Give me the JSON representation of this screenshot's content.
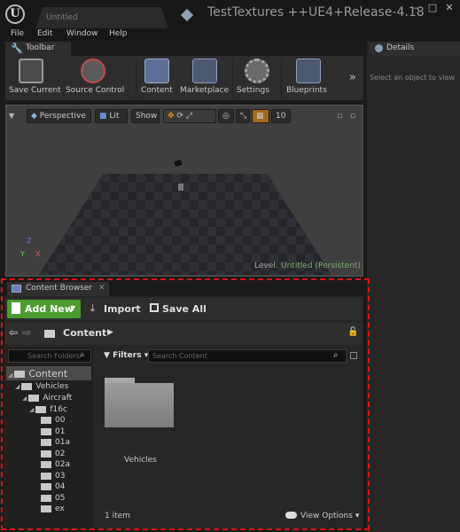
{
  "titlebar": {
    "tab_label": "Untitled",
    "window_title": "TestTextures ++UE4+Release-4.18",
    "controls": [
      "–",
      "□",
      "✕"
    ]
  },
  "menu": [
    "File",
    "Edit",
    "Window",
    "Help"
  ],
  "toolbar": {
    "tab_label": "Toolbar",
    "buttons": [
      "Save Current",
      "Source Control",
      "Content",
      "Marketplace",
      "Settings",
      "Blueprints"
    ]
  },
  "details": {
    "tab_label": "Details",
    "hint": "Select an object to view"
  },
  "viewport": {
    "perspective": "Perspective",
    "lit": "Lit",
    "show": "Show",
    "grid_value": "10",
    "level_label": "Level:",
    "level_name": "Untitled (Persistent)",
    "axes": [
      "Z",
      "X",
      "Y"
    ]
  },
  "content_browser": {
    "tab_label": "Content Browser",
    "add_new": "Add New",
    "import": "Import",
    "save_all": "Save All",
    "path": "Content",
    "tree_search_placeholder": "Search Folders",
    "filters": "Filters",
    "content_search_placeholder": "Search Content",
    "tree": [
      "Content",
      "Vehicles",
      "Aircraft",
      "f16c",
      "00",
      "01",
      "01a",
      "02",
      "02a",
      "03",
      "04",
      "05",
      "ex"
    ],
    "asset_name": "Vehicles",
    "item_count": "1 item",
    "view_options": "View Options"
  },
  "colors": {
    "add_new_green": "#4b9b2e",
    "highlight_red": "#e21212",
    "level_green": "#7fae6f"
  }
}
